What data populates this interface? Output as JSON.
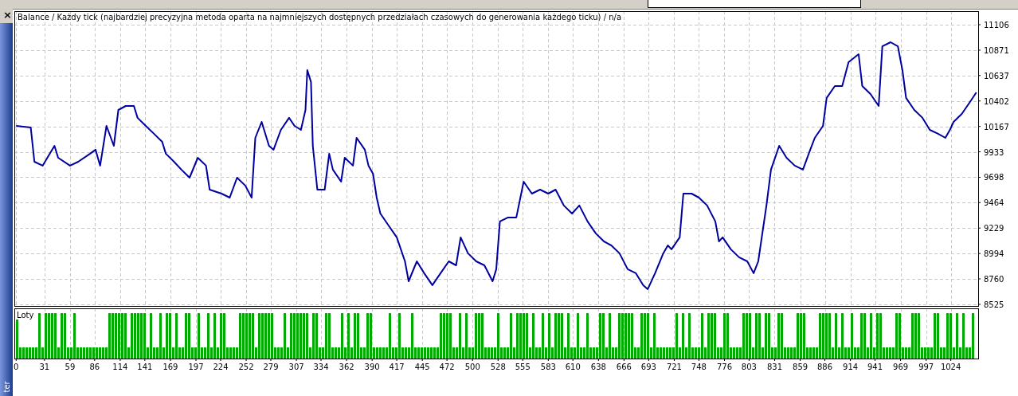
{
  "side_panel": {
    "close": "×",
    "label": "ter"
  },
  "balance_chart": {
    "title": "Balance / Każdy tick (najbardziej precyzyjna metoda oparta na najmniejszych dostępnych przedziałach czasowych do generowania każdego ticku) / n/a",
    "chart_data": {
      "type": "line",
      "x": [
        0,
        16,
        20,
        29,
        42,
        46,
        59,
        68,
        81,
        87,
        92,
        99,
        107,
        112,
        120,
        129,
        133,
        142,
        151,
        160,
        164,
        173,
        181,
        190,
        199,
        208,
        212,
        225,
        234,
        242,
        251,
        258,
        262,
        269,
        277,
        282,
        290,
        299,
        305,
        312,
        317,
        319,
        323,
        325,
        330,
        338,
        343,
        347,
        356,
        360,
        369,
        373,
        382,
        386,
        391,
        395,
        399,
        408,
        417,
        426,
        430,
        439,
        447,
        456,
        465,
        474,
        482,
        487,
        495,
        504,
        513,
        522,
        526,
        530,
        539,
        548,
        556,
        565,
        574,
        583,
        591,
        600,
        609,
        617,
        626,
        635,
        644,
        652,
        661,
        670,
        679,
        687,
        692,
        700,
        709,
        714,
        718,
        727,
        731,
        740,
        748,
        757,
        766,
        770,
        774,
        783,
        792,
        801,
        808,
        813,
        822,
        827,
        836,
        844,
        853,
        862,
        870,
        875,
        884,
        888,
        897,
        905,
        912,
        923,
        927,
        936,
        945,
        949,
        958,
        966,
        971,
        975,
        984,
        993,
        1001,
        1010,
        1018,
        1023,
        1027,
        1036,
        1045,
        1052
      ],
      "series": [
        {
          "color": "#0000a0",
          "values": [
            10172,
            10157,
            9841,
            9805,
            9988,
            9878,
            9805,
            9841,
            9915,
            9952,
            9805,
            10172,
            9988,
            10319,
            10356,
            10356,
            10246,
            10172,
            10099,
            10025,
            9915,
            9841,
            9768,
            9694,
            9878,
            9805,
            9584,
            9547,
            9510,
            9694,
            9621,
            9510,
            10062,
            10209,
            9988,
            9952,
            10135,
            10246,
            10172,
            10135,
            10319,
            10687,
            10577,
            9988,
            9584,
            9584,
            9915,
            9768,
            9657,
            9878,
            9805,
            10062,
            9952,
            9805,
            9731,
            9510,
            9363,
            9253,
            9143,
            8922,
            8738,
            8922,
            8812,
            8702,
            8812,
            8922,
            8885,
            9143,
            8996,
            8922,
            8885,
            8738,
            8849,
            9290,
            9327,
            9327,
            9657,
            9547,
            9584,
            9547,
            9584,
            9437,
            9363,
            9437,
            9290,
            9180,
            9106,
            9069,
            8996,
            8849,
            8812,
            8702,
            8665,
            8812,
            8996,
            9069,
            9033,
            9143,
            9547,
            9547,
            9510,
            9437,
            9290,
            9106,
            9143,
            9033,
            8959,
            8922,
            8812,
            8922,
            9437,
            9768,
            9988,
            9878,
            9805,
            9768,
            9952,
            10062,
            10172,
            10430,
            10540,
            10540,
            10760,
            10834,
            10540,
            10466,
            10356,
            10907,
            10944,
            10907,
            10687,
            10430,
            10319,
            10246,
            10135,
            10099,
            10062,
            10135,
            10209,
            10282,
            10393,
            10481
          ]
        }
      ],
      "grid": true,
      "xlim": [
        -2,
        1054
      ],
      "ylim": [
        8510,
        11231
      ],
      "xticks": [
        0,
        31,
        59,
        86,
        114,
        141,
        169,
        197,
        224,
        252,
        279,
        307,
        334,
        362,
        390,
        417,
        445,
        472,
        500,
        528,
        555,
        583,
        610,
        638,
        666,
        693,
        721,
        748,
        776,
        803,
        831,
        859,
        886,
        914,
        941,
        969,
        997,
        1024
      ],
      "yticks": [
        8525,
        8760,
        8994,
        9229,
        9464,
        9698,
        9933,
        10167,
        10402,
        10637,
        10871,
        11106
      ]
    }
  },
  "lots_chart": {
    "title": "Loty"
  }
}
